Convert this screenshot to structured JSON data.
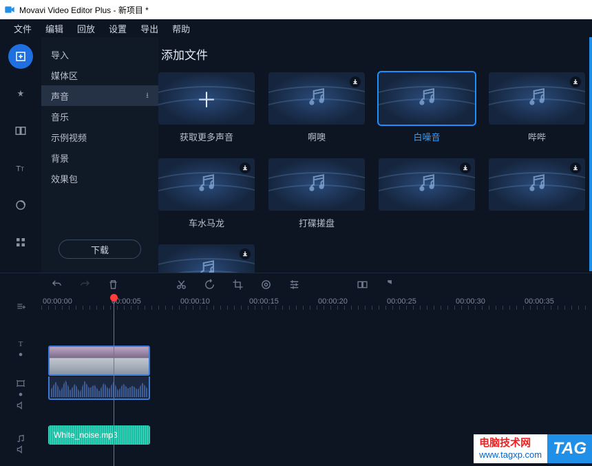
{
  "window": {
    "title": "Movavi Video Editor Plus - 新项目 *"
  },
  "menu": [
    "文件",
    "编辑",
    "回放",
    "设置",
    "导出",
    "帮助"
  ],
  "tools": [
    {
      "name": "import-tool",
      "selected": true
    },
    {
      "name": "filters-tool",
      "selected": false
    },
    {
      "name": "transitions-tool",
      "selected": false
    },
    {
      "name": "titles-tool",
      "selected": false
    },
    {
      "name": "stickers-tool",
      "selected": false
    },
    {
      "name": "more-tool",
      "selected": false
    }
  ],
  "sidebar": {
    "items": [
      {
        "label": "导入",
        "dl": false
      },
      {
        "label": "媒体区",
        "dl": false
      },
      {
        "label": "声音",
        "dl": true,
        "selected": true
      },
      {
        "label": "音乐",
        "dl": false
      },
      {
        "label": "示例视频",
        "dl": false
      },
      {
        "label": "背景",
        "dl": false
      },
      {
        "label": "效果包",
        "dl": false
      }
    ],
    "download_label": "下载"
  },
  "content": {
    "title": "添加文件",
    "cards": [
      {
        "name": "get-more-sounds",
        "label": "获取更多声音",
        "dl": false,
        "plus": true,
        "selected": false
      },
      {
        "name": "aoo",
        "label": "啊噢",
        "dl": true,
        "selected": false
      },
      {
        "name": "white-noise",
        "label": "白噪音",
        "dl": false,
        "selected": true
      },
      {
        "name": "bibi",
        "label": "哔哔",
        "dl": true,
        "selected": false
      },
      {
        "name": "traffic",
        "label": "车水马龙",
        "dl": true,
        "selected": false
      },
      {
        "name": "dj-scratch",
        "label": "打碟搓盘",
        "dl": false,
        "selected": false
      },
      {
        "name": "r7",
        "label": "",
        "dl": true,
        "selected": false
      },
      {
        "name": "r8",
        "label": "",
        "dl": true,
        "selected": false
      },
      {
        "name": "r9",
        "label": "",
        "dl": true,
        "selected": false
      }
    ]
  },
  "ruler": [
    "00:00:00",
    "00:00:05",
    "00:00:10",
    "00:00:15",
    "00:00:20",
    "00:00:25",
    "00:00:30",
    "00:00:35"
  ],
  "audio_clip": {
    "label": "White_noise.mp3"
  },
  "watermark": {
    "line1": "电脑技术网",
    "line2": "www.tagxp.com",
    "tag": "TAG"
  }
}
